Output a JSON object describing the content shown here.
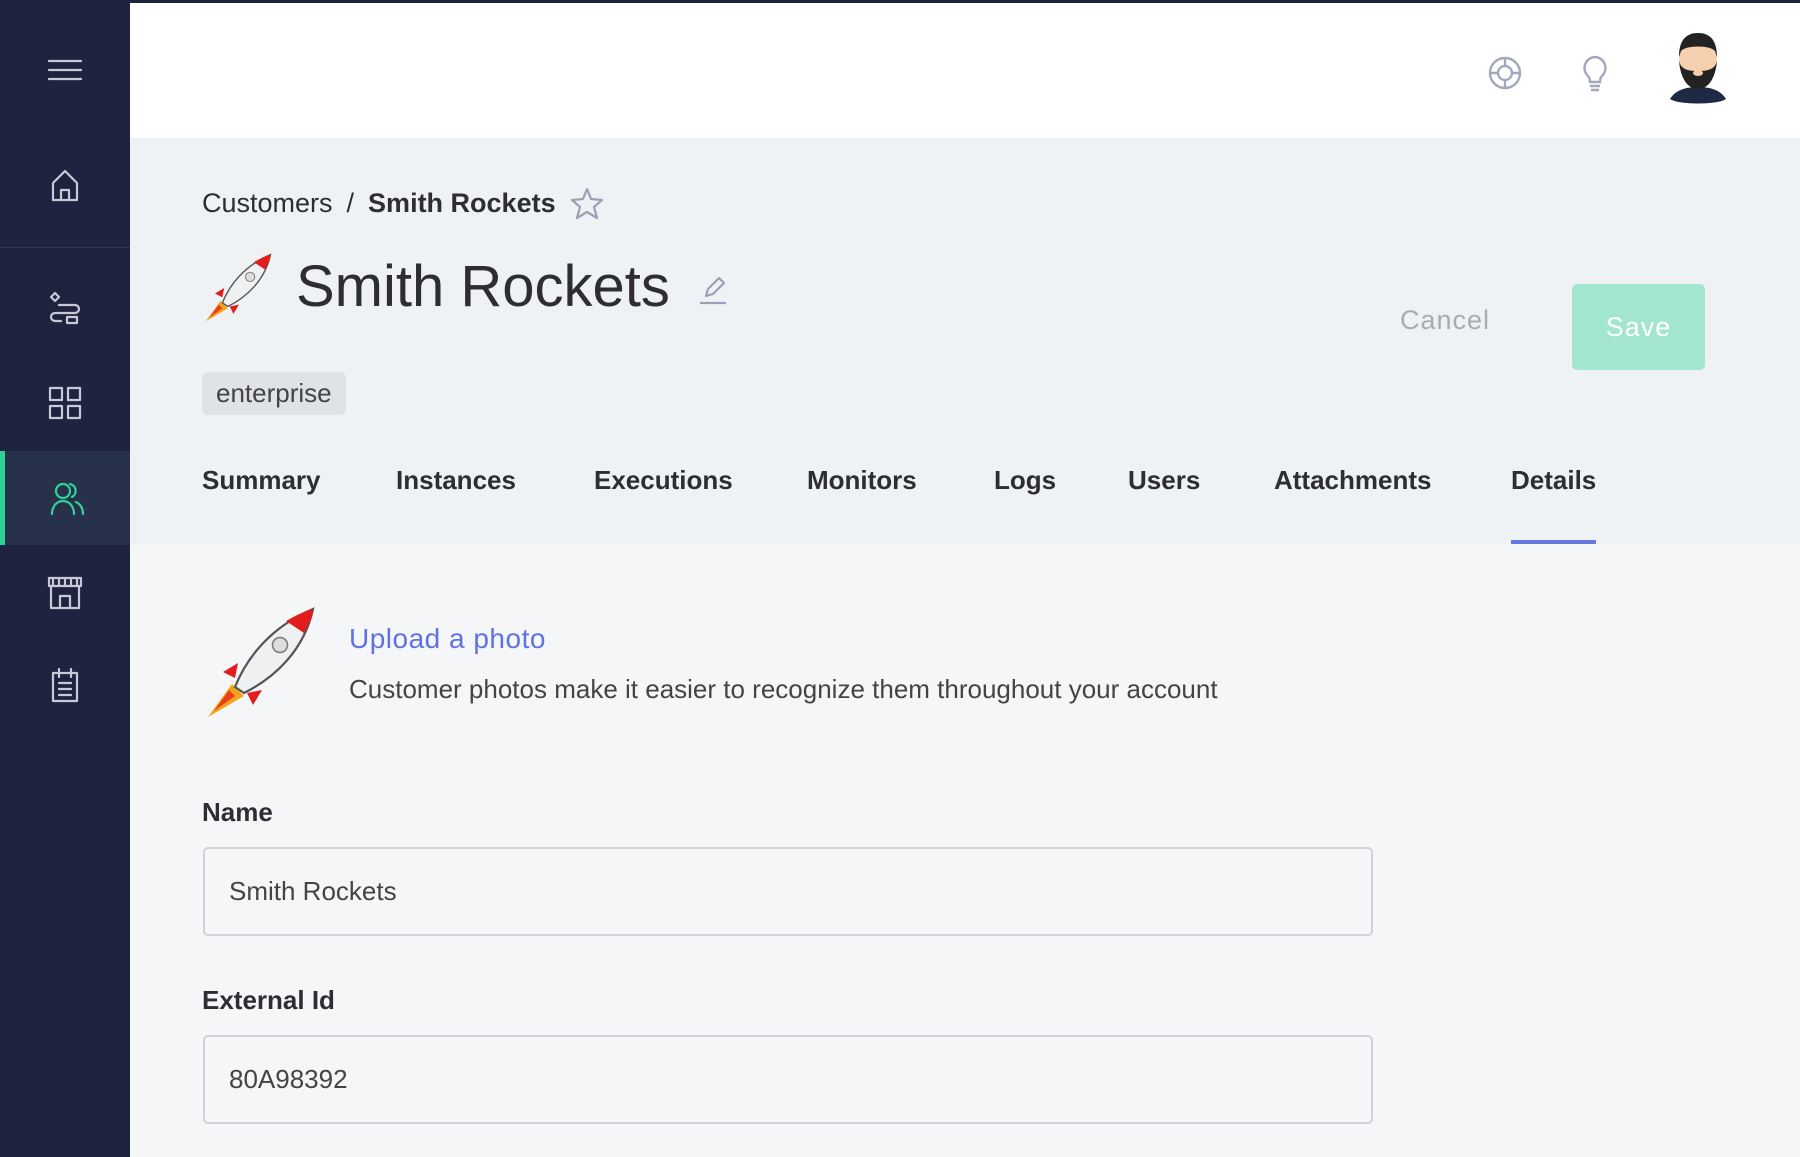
{
  "colors": {
    "sidebar": "#1e2340",
    "accent": "#2fd39a",
    "link": "#5e72e4",
    "save": "#a3e6cf"
  },
  "sidebar": {
    "items": [
      {
        "icon": "hamburger-icon"
      },
      {
        "icon": "home-icon"
      },
      {
        "icon": "flows-icon"
      },
      {
        "icon": "grid-icon"
      },
      {
        "icon": "customers-icon",
        "active": true
      },
      {
        "icon": "store-icon"
      },
      {
        "icon": "clipboard-icon"
      }
    ]
  },
  "header": {
    "icons": [
      "support-icon",
      "lightbulb-icon",
      "avatar"
    ]
  },
  "breadcrumb": {
    "parent": "Customers",
    "separator": "/",
    "current": "Smith Rockets"
  },
  "page": {
    "title": "Smith Rockets",
    "tag": "enterprise",
    "cancel_label": "Cancel",
    "save_label": "Save"
  },
  "tabs": [
    {
      "label": "Summary"
    },
    {
      "label": "Instances"
    },
    {
      "label": "Executions"
    },
    {
      "label": "Monitors"
    },
    {
      "label": "Logs"
    },
    {
      "label": "Users"
    },
    {
      "label": "Attachments"
    },
    {
      "label": "Details",
      "active": true
    }
  ],
  "photo": {
    "upload_label": "Upload a photo",
    "description": "Customer photos make it easier to recognize them throughout your account"
  },
  "form": {
    "name_label": "Name",
    "name_value": "Smith Rockets",
    "external_id_label": "External Id",
    "external_id_value": "80A98392"
  }
}
